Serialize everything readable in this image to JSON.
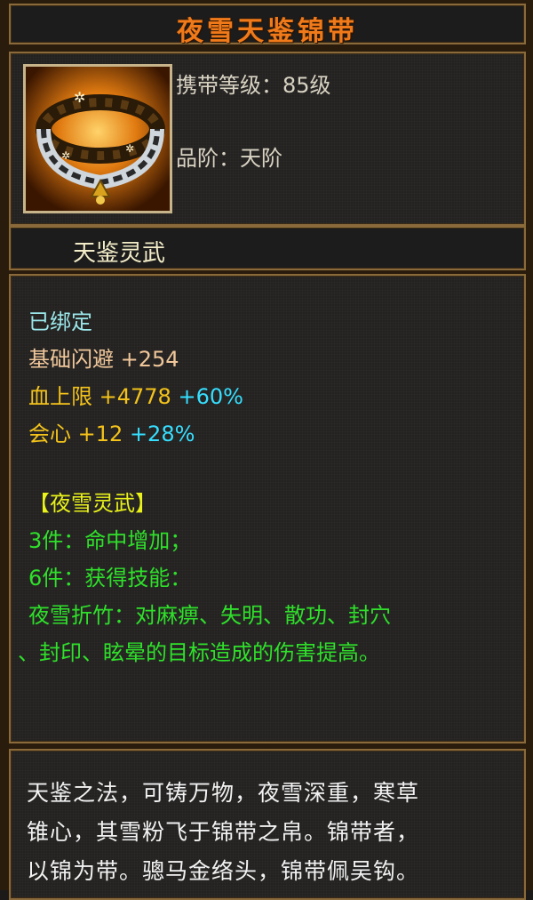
{
  "item": {
    "name": "夜雪天鉴锦带",
    "carry_level": "携带等级：85级",
    "grade": "品阶：天阶",
    "suit_name": "天鉴灵武",
    "icon": "belt-icon"
  },
  "stats": {
    "bound": "已绑定",
    "dodge_label": "基础闪避",
    "dodge_value": "+254",
    "hp_label": "血上限",
    "hp_value": "+4778",
    "hp_percent": "+60%",
    "crit_label": "会心",
    "crit_value": "+12",
    "crit_percent": "+28%"
  },
  "set": {
    "title": "【夜雪灵武】",
    "bonus3": "3件：命中增加；",
    "bonus6": "6件：获得技能：",
    "skill_line1": "夜雪折竹：对麻痹、失明、散功、封穴",
    "skill_line2": "、封印、眩晕的目标造成的伤害提高。"
  },
  "description": {
    "line1": "天鉴之法，可铸万物，夜雪深重，寒草",
    "line2": "锥心，其雪粉飞于锦带之帛。锦带者，",
    "line3": "以锦为带。骢马金络头，锦带佩吴钩。"
  },
  "colors": {
    "title": "#f07a1a",
    "bound": "#9be7ea",
    "base_stat": "#f0c79a",
    "stat_gold": "#f4c31a",
    "percent_cyan": "#36dfff",
    "set_green": "#2fe02a",
    "set_title_yellow": "#e9f21a",
    "border": "#8a6a3a"
  }
}
